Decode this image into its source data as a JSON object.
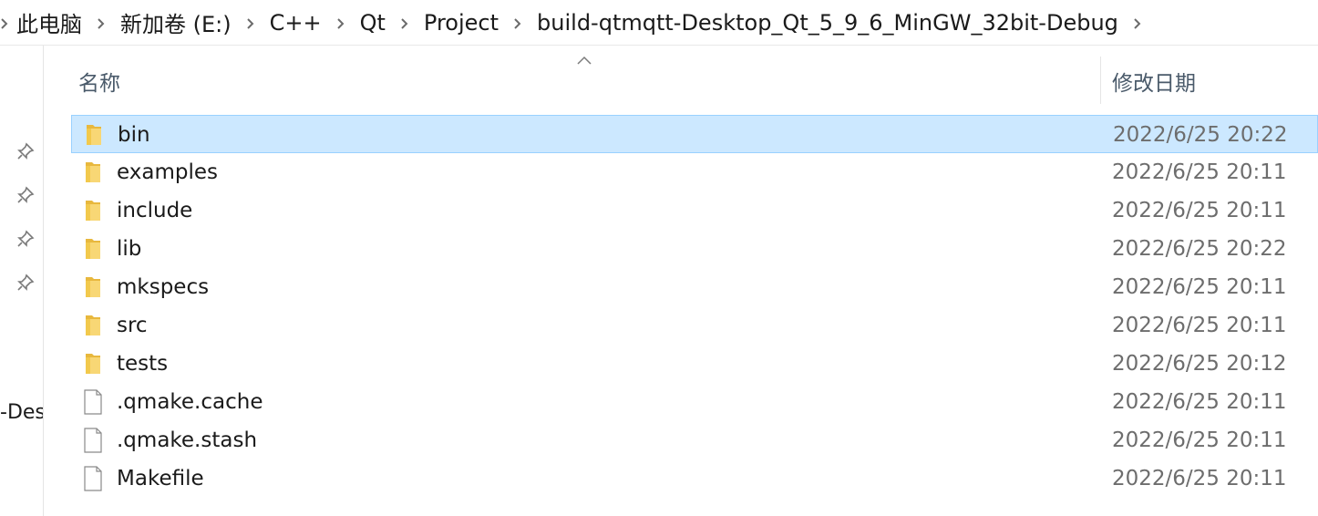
{
  "breadcrumb": {
    "items": [
      "此电脑",
      "新加卷 (E:)",
      "C++",
      "Qt",
      "Project",
      "build-qtmqtt-Desktop_Qt_5_9_6_MinGW_32bit-Debug"
    ]
  },
  "nav": {
    "cut_text": "-Des",
    "pins": [
      "pin-icon",
      "pin-icon",
      "pin-icon",
      "pin-icon"
    ]
  },
  "columns": {
    "name": "名称",
    "date": "修改日期"
  },
  "files": [
    {
      "name": "bin",
      "date": "2022/6/25 20:22",
      "type": "folder",
      "selected": true
    },
    {
      "name": "examples",
      "date": "2022/6/25 20:11",
      "type": "folder"
    },
    {
      "name": "include",
      "date": "2022/6/25 20:11",
      "type": "folder"
    },
    {
      "name": "lib",
      "date": "2022/6/25 20:22",
      "type": "folder"
    },
    {
      "name": "mkspecs",
      "date": "2022/6/25 20:11",
      "type": "folder"
    },
    {
      "name": "src",
      "date": "2022/6/25 20:11",
      "type": "folder"
    },
    {
      "name": "tests",
      "date": "2022/6/25 20:12",
      "type": "folder"
    },
    {
      "name": ".qmake.cache",
      "date": "2022/6/25 20:11",
      "type": "file"
    },
    {
      "name": ".qmake.stash",
      "date": "2022/6/25 20:11",
      "type": "file"
    },
    {
      "name": "Makefile",
      "date": "2022/6/25 20:11",
      "type": "file"
    }
  ],
  "colors": {
    "selection_bg": "#cce8ff",
    "selection_border": "#99d1ff",
    "folder": "#f8d775"
  }
}
